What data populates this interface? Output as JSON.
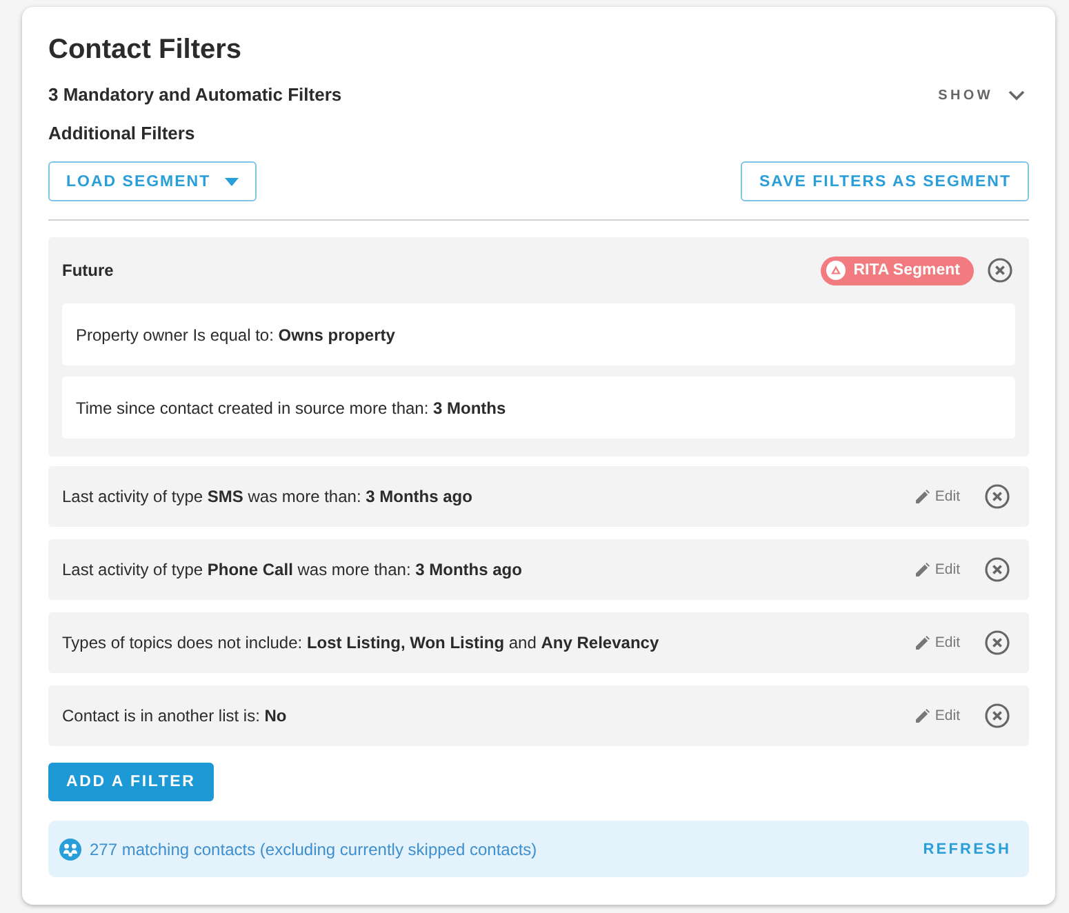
{
  "title": "Contact Filters",
  "mandatory": {
    "label": "3 Mandatory and Automatic Filters",
    "toggle": "SHOW",
    "expanded": false
  },
  "additional": {
    "label": "Additional Filters"
  },
  "segment_buttons": {
    "load": "LOAD SEGMENT",
    "save": "SAVE FILTERS AS SEGMENT"
  },
  "filters": [
    {
      "kind": "segment",
      "name": "Future",
      "badge": "RITA Segment",
      "conditions": [
        "Property owner Is equal to: **Owns property**",
        "Time since contact created in source more than: **3 Months**"
      ]
    },
    {
      "kind": "filter",
      "text": "Last activity of type **SMS** was more than: **3 Months ago**",
      "edit": "Edit"
    },
    {
      "kind": "filter",
      "text": "Last activity of type **Phone Call** was more than: **3 Months ago**",
      "edit": "Edit"
    },
    {
      "kind": "filter",
      "text": "Types of topics does not include: **Lost Listing, Won Listing** and **Any Relevancy**",
      "edit": "Edit"
    },
    {
      "kind": "filter",
      "text": "Contact is in another list is: **No**",
      "edit": "Edit"
    }
  ],
  "add_button": "ADD A FILTER",
  "summary": {
    "text": "277 matching contacts (excluding currently skipped contacts)",
    "action": "REFRESH"
  }
}
